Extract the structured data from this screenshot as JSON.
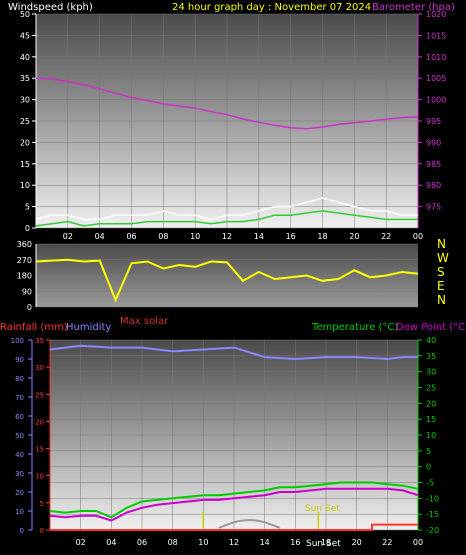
{
  "colors": {
    "background": "#000000",
    "panel_top": "#505050",
    "panel_bottom": "#eeeeee",
    "axis_text": "#ffffff",
    "title": "#ffff00",
    "barometer": "#cc33cc",
    "wind": "#ffffff",
    "gust": "#33cc33",
    "direction": "#ffff00",
    "rain": "#ff3333",
    "humidity": "#8888ff",
    "temperature": "#00cc00",
    "dewpoint": "#cc00cc",
    "solar": "#999999",
    "sun": "#cccc00",
    "solar_label": "#cc3333"
  },
  "header": {
    "wind_label": "Windspeed (kph)",
    "title": "24 hour graph day : November 07 2024",
    "baro_label": "Barometer (hpa)"
  },
  "bottom_header": {
    "rain_label": "Rainfall (mm)",
    "humidity_label": "Humidity",
    "temp_label": "Temperature (°C)",
    "dew_label": "Dew Point (°C)",
    "max_solar": "Max solar"
  },
  "compass": [
    "N",
    "W",
    "S",
    "E",
    "N"
  ],
  "annotations": {
    "sunset1": "Sun Set",
    "sunset2": "Sun Set"
  },
  "chart_data": [
    {
      "type": "line",
      "x_ticks": [
        "02",
        "04",
        "06",
        "08",
        "10",
        "12",
        "14",
        "16",
        "18",
        "20",
        "22",
        "00"
      ],
      "left_axis": {
        "ticks": [
          0,
          5,
          10,
          15,
          20,
          25,
          30,
          35,
          40,
          45,
          50
        ],
        "ylim": [
          0,
          50
        ]
      },
      "right_axis": {
        "ticks": [
          975,
          980,
          985,
          990,
          995,
          1000,
          1005,
          1010,
          1015,
          1020
        ],
        "ylim": [
          970,
          1020
        ]
      },
      "series": [
        {
          "axis": "right",
          "x": [
            0,
            1,
            2,
            3,
            4,
            5,
            6,
            7,
            8,
            9,
            10,
            11,
            12,
            13,
            14,
            15,
            16,
            17,
            18,
            19,
            20,
            21,
            22,
            23,
            24
          ],
          "values": [
            1005,
            1004.8,
            1004.2,
            1003.5,
            1002.5,
            1001.5,
            1000.5,
            999.8,
            999,
            998.5,
            998,
            997.2,
            996.5,
            995.5,
            994.7,
            994,
            993.4,
            993.2,
            993.6,
            994.2,
            994.6,
            995,
            995.4,
            995.8,
            996
          ]
        },
        {
          "axis": "left",
          "x": [
            0,
            1,
            2,
            3,
            4,
            5,
            6,
            7,
            8,
            9,
            10,
            11,
            12,
            13,
            14,
            15,
            16,
            17,
            18,
            19,
            20,
            21,
            22,
            23,
            24
          ],
          "values": [
            2,
            3,
            3,
            2,
            2,
            3,
            3,
            3,
            4,
            3,
            3,
            2,
            3,
            3,
            4,
            5,
            5,
            6,
            7,
            6,
            5,
            4,
            4,
            3,
            3
          ]
        },
        {
          "axis": "left",
          "x": [
            0,
            1,
            2,
            3,
            4,
            5,
            6,
            7,
            8,
            9,
            10,
            11,
            12,
            13,
            14,
            15,
            16,
            17,
            18,
            19,
            20,
            21,
            22,
            23,
            24
          ],
          "values": [
            0.5,
            1,
            1.5,
            0.5,
            1,
            1,
            1,
            1.5,
            1.5,
            1.5,
            1.5,
            1,
            1.5,
            1.5,
            2,
            3,
            3,
            3.5,
            4,
            3.5,
            3,
            2.5,
            2,
            2,
            2
          ]
        }
      ]
    },
    {
      "type": "line",
      "x_ticks": [
        "02",
        "04",
        "06",
        "08",
        "10",
        "12",
        "14",
        "16",
        "18",
        "20",
        "22",
        "00"
      ],
      "y_ticks": [
        0,
        90,
        180,
        270,
        360
      ],
      "ylim": [
        0,
        360
      ],
      "series": [
        {
          "x": [
            0,
            1,
            2,
            3,
            4,
            5,
            6,
            7,
            8,
            9,
            10,
            11,
            12,
            13,
            14,
            15,
            16,
            17,
            18,
            19,
            20,
            21,
            22,
            23,
            24
          ],
          "values": [
            260,
            265,
            270,
            260,
            265,
            40,
            250,
            260,
            220,
            240,
            230,
            260,
            255,
            150,
            200,
            160,
            170,
            180,
            150,
            160,
            210,
            170,
            180,
            200,
            190
          ]
        }
      ]
    },
    {
      "type": "line",
      "x_ticks": [
        "02",
        "04",
        "06",
        "08",
        "10",
        "12",
        "14",
        "16",
        "18",
        "20",
        "22",
        "00"
      ],
      "rain_axis": {
        "ticks": [
          0,
          5,
          10,
          15,
          20,
          25,
          30,
          35
        ],
        "ylim": [
          0,
          35
        ]
      },
      "humidity_axis": {
        "ticks": [
          0,
          10,
          20,
          30,
          40,
          50,
          60,
          70,
          80,
          90,
          100
        ],
        "ylim": [
          0,
          100
        ]
      },
      "temp_axis": {
        "ticks": [
          -20,
          -15,
          -10,
          -5,
          0,
          5,
          10,
          15,
          20,
          25,
          30,
          35,
          40
        ],
        "ylim": [
          -20,
          40
        ]
      },
      "series": [
        {
          "axis": "humidity",
          "x": [
            0,
            2,
            4,
            6,
            8,
            10,
            12,
            14,
            16,
            18,
            20,
            22,
            23,
            24
          ],
          "values": [
            95,
            97,
            96,
            96,
            94,
            95,
            96,
            91,
            90,
            91,
            91,
            90,
            91,
            91
          ]
        },
        {
          "axis": "temp",
          "x": [
            0,
            1,
            2,
            3,
            4,
            5,
            6,
            7,
            8,
            9,
            10,
            11,
            12,
            13,
            14,
            15,
            16,
            17,
            18,
            19,
            20,
            21,
            22,
            23,
            24
          ],
          "values": [
            -14,
            -14.5,
            -14,
            -14,
            -16,
            -13,
            -11,
            -10.5,
            -10,
            -9.5,
            -9,
            -9,
            -8.5,
            -8,
            -7.5,
            -6.5,
            -6.5,
            -6,
            -5.5,
            -5,
            -5,
            -5,
            -5.5,
            -6,
            -7
          ]
        },
        {
          "axis": "temp",
          "x": [
            0,
            1,
            2,
            3,
            4,
            5,
            6,
            7,
            8,
            9,
            10,
            11,
            12,
            13,
            14,
            15,
            16,
            17,
            18,
            19,
            20,
            21,
            22,
            23,
            24
          ],
          "values": [
            -15.5,
            -16,
            -15.5,
            -15.5,
            -17,
            -14.5,
            -13,
            -12,
            -11.5,
            -11,
            -10.5,
            -10.5,
            -10,
            -9.5,
            -9,
            -8,
            -8,
            -7.5,
            -7,
            -7,
            -7,
            -7,
            -7,
            -7.5,
            -9
          ]
        },
        {
          "axis": "rain",
          "x": [
            0,
            21,
            21,
            24
          ],
          "values": [
            0,
            0,
            1,
            1
          ]
        }
      ]
    }
  ]
}
